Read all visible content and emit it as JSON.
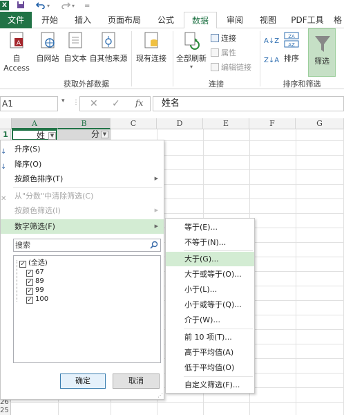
{
  "quick_access": {
    "logo": "X",
    "undo_icon": "undo-icon",
    "redo_icon": "redo-icon",
    "customize": "="
  },
  "tabs": [
    {
      "label": "文件"
    },
    {
      "label": "开始"
    },
    {
      "label": "插入"
    },
    {
      "label": "页面布局"
    },
    {
      "label": "公式"
    },
    {
      "label": "数据"
    },
    {
      "label": "审阅"
    },
    {
      "label": "视图"
    },
    {
      "label": "PDF工具"
    },
    {
      "label": "格"
    }
  ],
  "ribbon": {
    "get_external": {
      "buttons": [
        "自 Access",
        "自网站",
        "自文本",
        "自其他来源",
        "现有连接"
      ],
      "group_label": "获取外部数据"
    },
    "connections": {
      "refresh_all": "全部刷新",
      "refresh_arrow": "▾",
      "connections": "连接",
      "properties": "属性",
      "edit_links": "编辑链接",
      "group_label": "连接"
    },
    "sort_filter": {
      "sort_az": "A↓Z",
      "sort_za": "Z↓A",
      "sort": "排序",
      "filter": "筛选",
      "group_label": "排序和筛选"
    }
  },
  "formula_bar": {
    "name_box": "A1",
    "name_arrow": "▾",
    "dots": "⋮",
    "cancel": "✕",
    "enter": "✓",
    "fx": "fx",
    "value": "姓名"
  },
  "grid": {
    "columns": [
      "A",
      "B",
      "C",
      "D",
      "E",
      "F",
      "G"
    ],
    "row1": "1",
    "a1_text": "姓",
    "b1_text": "分",
    "bottom_rows": [
      "26",
      "25"
    ]
  },
  "filter_menu": {
    "sort_asc": "升序(S)",
    "sort_desc": "降序(O)",
    "sort_by_color": "按颜色排序(T)",
    "clear_filter": "从\"分数\"中清除筛选(C)",
    "filter_by_color": "按颜色筛选(I)",
    "number_filters": "数字筛选(F)",
    "search_placeholder": "搜索",
    "values": [
      {
        "label": "(全选)",
        "checked": true
      },
      {
        "label": "67",
        "checked": true
      },
      {
        "label": "89",
        "checked": true
      },
      {
        "label": "99",
        "checked": true
      },
      {
        "label": "100",
        "checked": true
      }
    ],
    "ok": "确定",
    "cancel": "取消",
    "checkmark": "✓"
  },
  "number_filter_submenu": [
    "等于(E)...",
    "不等于(N)...",
    "大于(G)...",
    "大于或等于(O)...",
    "小于(L)...",
    "小于或等于(Q)...",
    "介于(W)...",
    "前 10 项(T)...",
    "高于平均值(A)",
    "低于平均值(O)",
    "自定义筛选(F)..."
  ],
  "colors": {
    "accent": "#217346",
    "highlight": "#d3ecd3"
  }
}
